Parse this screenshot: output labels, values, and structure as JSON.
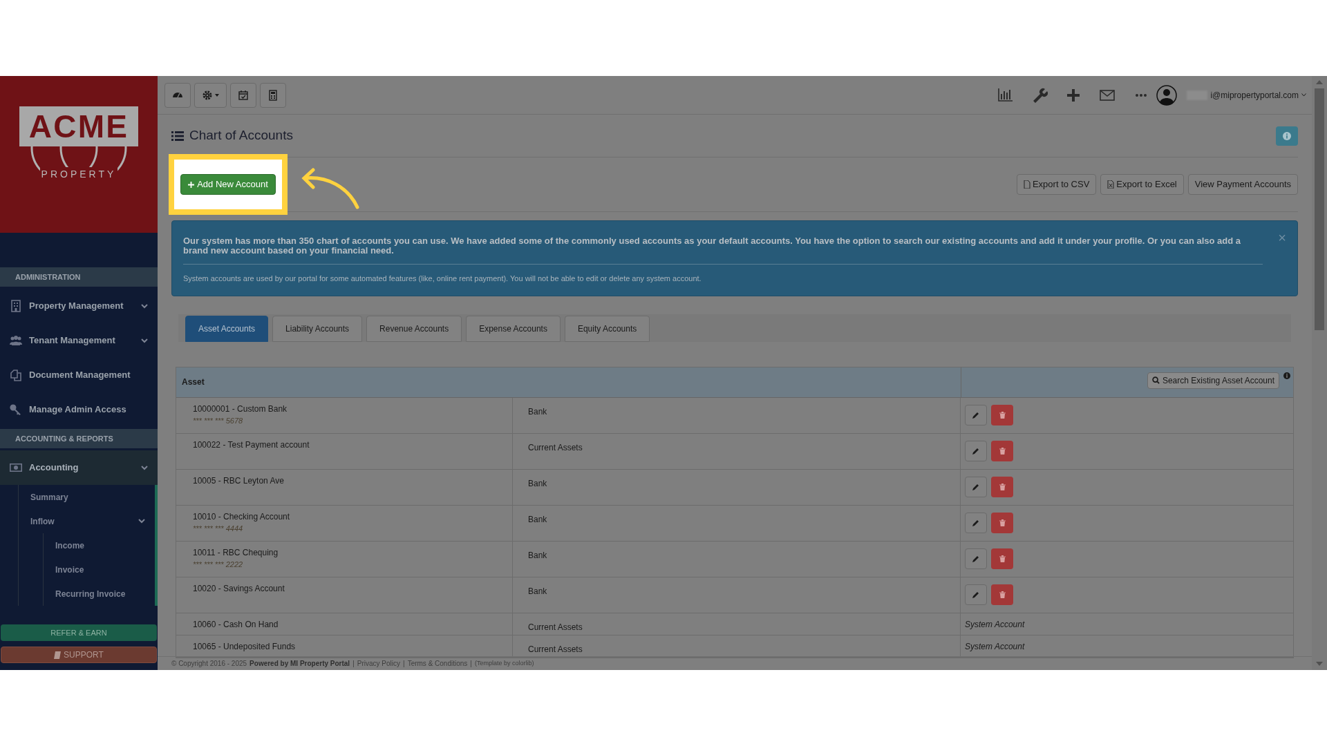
{
  "sidebar": {
    "logo": {
      "word": "ACME",
      "subtitle": "PROPERTY"
    },
    "sections": [
      {
        "title": "ADMINISTRATION",
        "items": [
          {
            "label": "Property Management",
            "kind": "menu",
            "selected": false
          },
          {
            "label": "Tenant Management",
            "kind": "menu",
            "selected": false
          },
          {
            "label": "Document Management",
            "kind": "link",
            "selected": false
          },
          {
            "label": "Manage Admin Access",
            "kind": "link",
            "selected": false
          }
        ]
      },
      {
        "title": "ACCOUNTING & REPORTS",
        "items": [
          {
            "label": "Accounting",
            "kind": "menu",
            "selected": true,
            "children": [
              {
                "label": "Summary",
                "kind": "link"
              },
              {
                "label": "Inflow",
                "kind": "menu",
                "children": [
                  {
                    "label": "Income"
                  },
                  {
                    "label": "Invoice"
                  },
                  {
                    "label": "Recurring Invoice"
                  }
                ]
              }
            ]
          }
        ]
      }
    ],
    "refer_button": "REFER & EARN",
    "support_button": "SUPPORT"
  },
  "user": {
    "email": "i@mipropertyportal.com"
  },
  "page": {
    "title": "Chart of Accounts",
    "add_button": "Add New Account",
    "actions": [
      "Export to CSV",
      "Export to Excel",
      "View Payment Accounts"
    ],
    "notice": {
      "main": "Our system has more than 350 chart of accounts you can use. We have added some of the commonly used accounts as your default accounts. You have the option to search our existing accounts and add it under your profile. Or you can also add a brand new account based on your financial need.",
      "note": "System accounts are used by our portal for some automated features (like, online rent payment). You will not be able to edit or delete any system account.",
      "close": "×"
    },
    "tabs": [
      {
        "label": "Asset Accounts",
        "selected": true
      },
      {
        "label": "Liability Accounts",
        "selected": false
      },
      {
        "label": "Revenue Accounts",
        "selected": false
      },
      {
        "label": "Expense Accounts",
        "selected": false
      },
      {
        "label": "Equity Accounts",
        "selected": false
      }
    ],
    "table": {
      "heading": "Asset",
      "search_button": "Search Existing Asset Account",
      "rows": [
        {
          "name": "10000001 - Custom Bank",
          "masked_number": "*** *** *** 5678",
          "type": "Bank",
          "kind": "editable"
        },
        {
          "name": "100022 - Test Payment account",
          "type": "Current Assets",
          "kind": "editable"
        },
        {
          "name": "10005 - RBC Leyton Ave",
          "type": "Bank",
          "kind": "editable"
        },
        {
          "name": "10010 - Checking Account",
          "masked_number": "*** *** *** 4444",
          "type": "Bank",
          "kind": "editable"
        },
        {
          "name": "10011 - RBC Chequing",
          "masked_number": "*** *** *** 2222",
          "type": "Bank",
          "kind": "editable"
        },
        {
          "name": "10020 - Savings Account",
          "type": "Bank",
          "kind": "editable"
        },
        {
          "name": "10060 - Cash On Hand",
          "type": "Current Assets",
          "kind": "system",
          "note": "System Account"
        },
        {
          "name": "10065 - Undeposited Funds",
          "type": "Current Assets",
          "kind": "system",
          "note": "System Account"
        }
      ]
    }
  },
  "footer": {
    "copyright": "© Copyright 2016 - 2025",
    "powered": "Powered by MI Property Portal",
    "items": [
      {
        "separator": "|",
        "text": "Privacy Policy",
        "kind": "link"
      },
      {
        "separator": "|",
        "text": "Terms & Conditions",
        "kind": "link"
      },
      {
        "separator": "|",
        "text": "(Template by colorlib)",
        "kind": "credit"
      }
    ]
  }
}
